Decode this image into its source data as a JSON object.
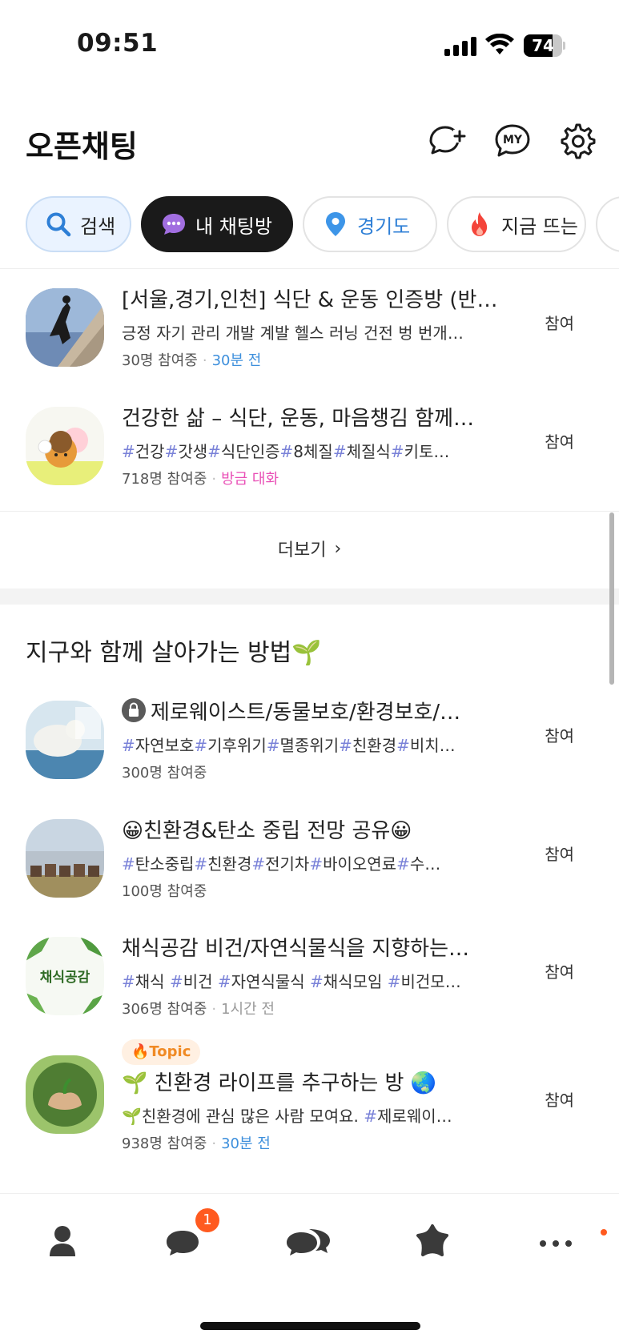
{
  "status_bar": {
    "time": "09:51",
    "battery_level": "74",
    "battery_fraction": 0.74
  },
  "header": {
    "title": "오픈채팅",
    "icons": [
      "new-chat-icon",
      "my-chat-icon",
      "settings-icon"
    ]
  },
  "chips": [
    {
      "label": "검색",
      "icon": "search-icon"
    },
    {
      "label": "내 채팅방",
      "icon": "chat-bubble-icon",
      "active": true
    },
    {
      "label": "경기도",
      "icon": "location-pin-icon"
    },
    {
      "label": "지금 뜨는",
      "icon": "fire-icon"
    }
  ],
  "top_rooms": [
    {
      "title": "[서울,경기,인천] 식단 & 운동 인증방 (반…",
      "desc": "긍정 자기 관리 개발 계발 헬스 러닝 건전 벙 번개…",
      "members": "30명 참여중",
      "time": "30분 전",
      "join_label": "참여"
    },
    {
      "title": "건강한 삶 – 식단, 운동, 마음챙김 함께…",
      "desc_tags": [
        "건강",
        "갓생",
        "식단인증",
        "8체질",
        "체질식",
        "키토…"
      ],
      "members": "718명 참여중",
      "time": "방금 대화",
      "join_label": "참여"
    }
  ],
  "more_label": "더보기",
  "section": {
    "title": "지구와 함께 살아가는 방법🌱",
    "rooms": [
      {
        "title": "제로웨이스트/동물보호/환경보호/…",
        "locked": true,
        "desc_tags": [
          "자연보호",
          "기후위기",
          "멸종위기",
          "친환경",
          "비치…"
        ],
        "members": "300명 참여중",
        "join_label": "참여"
      },
      {
        "title": "😀친환경&탄소 중립 전망 공유😀",
        "desc_tags": [
          "탄소중립",
          "친환경",
          "전기차",
          "바이오연료",
          "수…"
        ],
        "members": "100명 참여중",
        "join_label": "참여"
      },
      {
        "title": "채식공감 비건/자연식물식을 지향하는…",
        "desc_tags": [
          "채식 ",
          "비건 ",
          "자연식물식 ",
          "채식모임 ",
          "비건모…"
        ],
        "members": "306명 참여중",
        "time": "1시간 전",
        "thumb_text": "채식공감",
        "join_label": "참여"
      },
      {
        "topic_badge": "🔥Topic",
        "title": "🌱 친환경 라이프를 추구하는 방 🌏",
        "desc_prefix": "🌱친환경에 관심 많은 사람 모여요. ",
        "desc_tag": "제로웨이…",
        "members": "938명 참여중",
        "time": "30분 전",
        "join_label": "참여"
      }
    ]
  },
  "tab_bar": {
    "items": [
      "friends-icon",
      "chats-icon",
      "open-chat-icon",
      "shopping-icon",
      "more-icon"
    ],
    "chat_badge": "1"
  }
}
